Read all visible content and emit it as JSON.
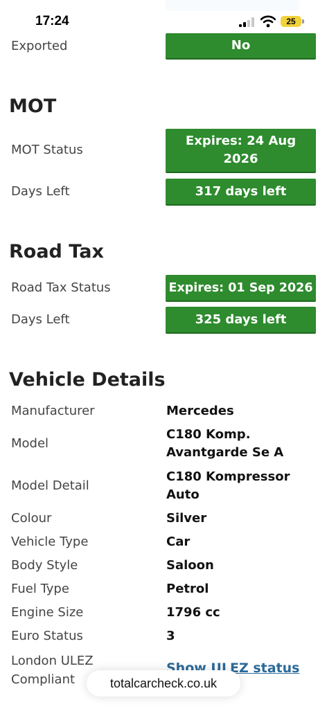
{
  "status_bar": {
    "time": "17:24",
    "battery": "25"
  },
  "colors": {
    "green": "#2e8b2e",
    "link": "#2a6a99",
    "battery": "#f2d23b"
  },
  "exported": {
    "label": "Exported",
    "value": "No"
  },
  "mot": {
    "title": "MOT",
    "status_label": "MOT Status",
    "status_value": "Expires: 24 Aug 2026",
    "days_label": "Days Left",
    "days_value": "317 days left"
  },
  "road_tax": {
    "title": "Road Tax",
    "status_label": "Road Tax Status",
    "status_value": "Expires: 01 Sep 2026",
    "days_label": "Days Left",
    "days_value": "325 days left"
  },
  "vehicle": {
    "title": "Vehicle Details",
    "rows": [
      {
        "label": "Manufacturer",
        "value": "Mercedes"
      },
      {
        "label": "Model",
        "value": "C180 Komp. Avantgarde Se A"
      },
      {
        "label": "Model Detail",
        "value": "C180 Kompressor Auto"
      },
      {
        "label": "Colour",
        "value": "Silver"
      },
      {
        "label": "Vehicle Type",
        "value": "Car"
      },
      {
        "label": "Body Style",
        "value": "Saloon"
      },
      {
        "label": "Fuel Type",
        "value": "Petrol"
      },
      {
        "label": "Engine Size",
        "value": "1796 cc"
      },
      {
        "label": "Euro Status",
        "value": "3"
      },
      {
        "label": "London ULEZ Compliant",
        "value": "Show ULEZ status"
      }
    ]
  },
  "browser": {
    "url": "totalcarcheck.co.uk"
  }
}
